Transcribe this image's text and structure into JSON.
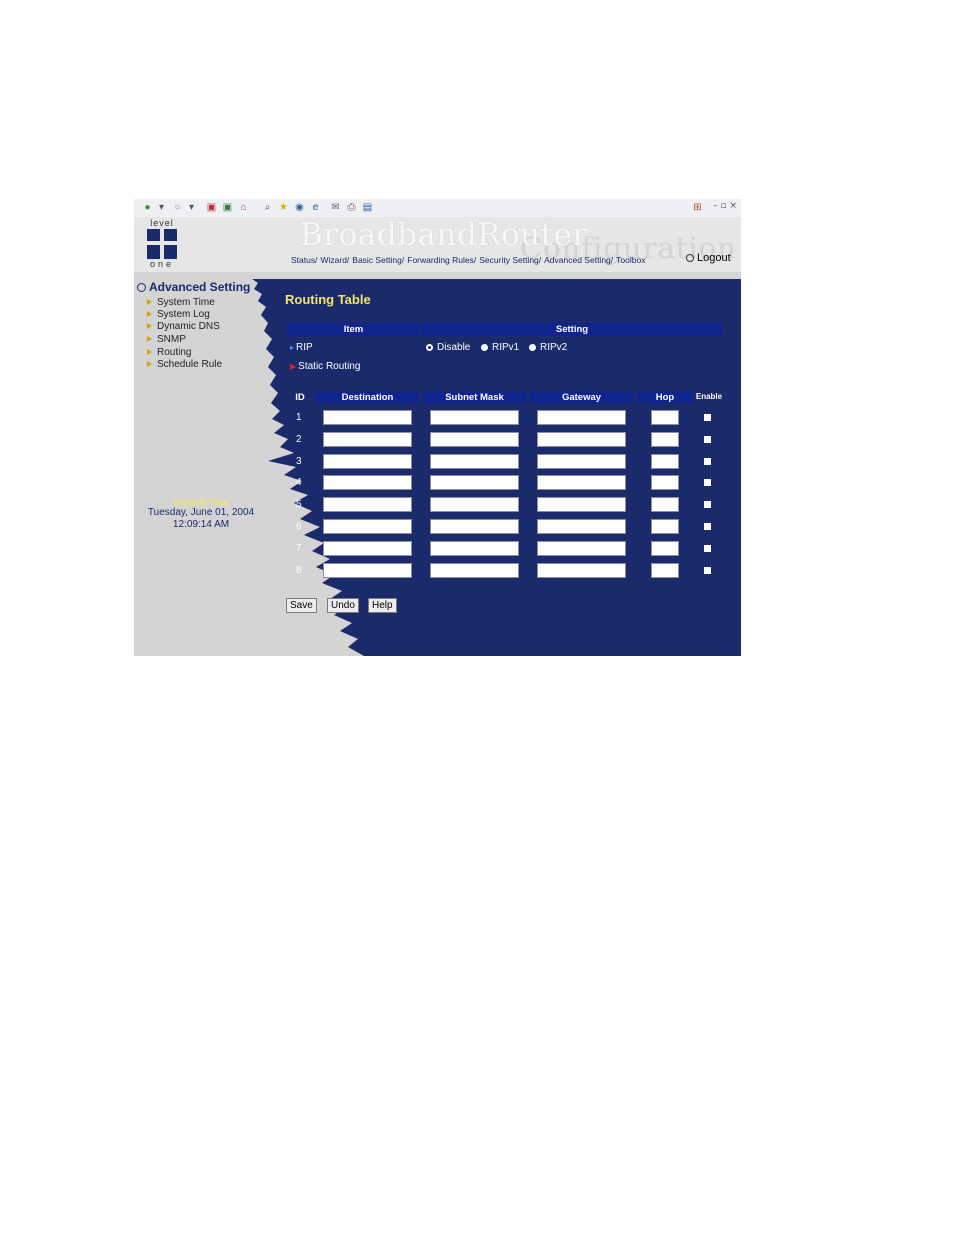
{
  "browser": {
    "toolbar_icons": [
      "back-icon",
      "dropdown-icon",
      "forward-icon",
      "dropdown-icon",
      "stop-icon",
      "refresh-icon",
      "home-icon",
      "search-icon",
      "favorites-icon",
      "media-icon",
      "ie-icon",
      "mail-icon",
      "print-icon",
      "edit-icon"
    ],
    "window_controls": "– ▫ ×"
  },
  "header": {
    "logo_top": "level",
    "logo_bottom": "one",
    "brand": "BroadbandRouter",
    "brand_watermark": "Configuration",
    "nav": [
      "Status/",
      "Wizard/",
      "Basic Setting/",
      "Forwarding Rules/",
      "Security Setting/",
      "Advanced Setting/",
      "Toolbox"
    ],
    "logout": "Logout"
  },
  "sidebar": {
    "title": "Advanced Setting",
    "items": [
      {
        "label": "System Time"
      },
      {
        "label": "System Log"
      },
      {
        "label": "Dynamic DNS"
      },
      {
        "label": "SNMP"
      },
      {
        "label": "Routing"
      },
      {
        "label": "Schedule Rule"
      }
    ],
    "current_time_label": "Current Time",
    "current_date": "Tuesday, June 01, 2004",
    "current_clock": "12:09:14 AM"
  },
  "main": {
    "title": "Routing Table",
    "header_item": "Item",
    "header_setting": "Setting",
    "rip_label": "RIP",
    "rip_options": [
      "Disable",
      "RIPv1",
      "RIPv2"
    ],
    "rip_selected": "Disable",
    "static_label": "Static Routing",
    "columns": [
      "ID",
      "Destination",
      "Subnet Mask",
      "Gateway",
      "Hop",
      "Enable"
    ],
    "rows": [
      {
        "id": "1"
      },
      {
        "id": "2"
      },
      {
        "id": "3"
      },
      {
        "id": "4"
      },
      {
        "id": "5"
      },
      {
        "id": "6"
      },
      {
        "id": "7"
      },
      {
        "id": "8"
      }
    ],
    "buttons": {
      "save": "Save",
      "undo": "Undo",
      "help": "Help"
    }
  },
  "colors": {
    "panel_blue": "#1a2a6b",
    "header_bar": "#10248e",
    "title_yellow": "#f3e46a",
    "sidebar_gray": "#d4d4d4"
  }
}
